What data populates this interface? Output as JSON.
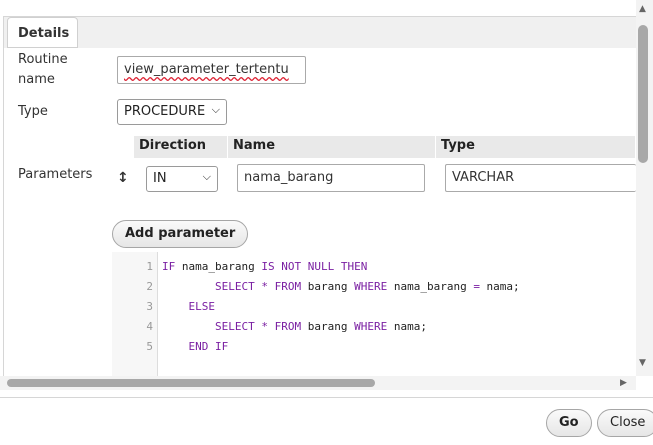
{
  "tab": {
    "label": "Details"
  },
  "fields": {
    "routine_name_label_1": "Routine",
    "routine_name_label_2": "name",
    "routine_name_value": "view_parameter_tertentu",
    "type_label": "Type",
    "type_value": "PROCEDURE",
    "parameters_label": "Parameters"
  },
  "params_table": {
    "headers": [
      "Direction",
      "Name",
      "Type"
    ],
    "row": {
      "direction": "IN",
      "name": "nama_barang",
      "type": "VARCHAR"
    }
  },
  "add_parameter_label": "Add parameter",
  "code": {
    "line_numbers": [
      "1",
      "2",
      "3",
      "4",
      "5"
    ]
  },
  "footer": {
    "go_label": "Go",
    "close_label": "Close"
  },
  "icons": {
    "sort": "up-down-arrow-icon",
    "dropdown": "chevron-down-icon"
  }
}
